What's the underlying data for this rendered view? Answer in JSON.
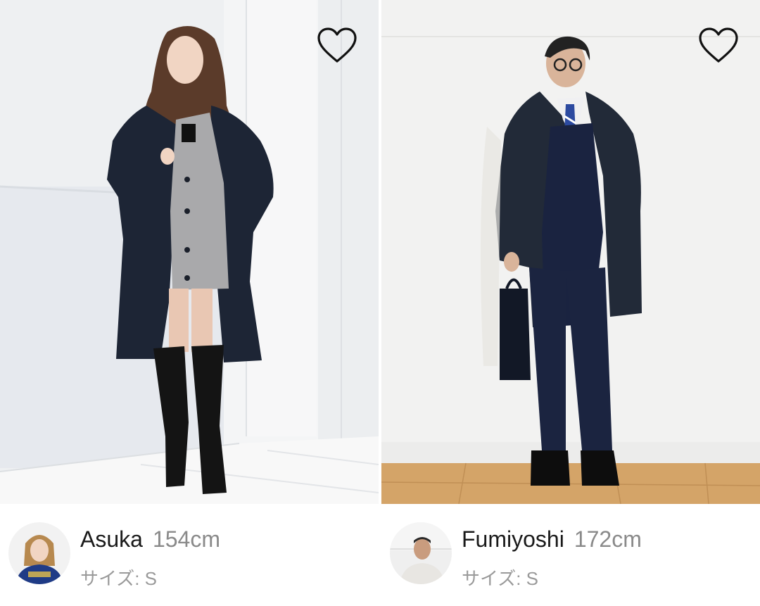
{
  "cards": [
    {
      "name": "Asuka",
      "height": "154cm",
      "size_label": "サイズ: S",
      "favorite_icon": "heart-outline-icon"
    },
    {
      "name": "Fumiyoshi",
      "height": "172cm",
      "size_label": "サイズ: S",
      "favorite_icon": "heart-outline-icon"
    }
  ],
  "colors": {
    "wall": "#f1f2f3",
    "navy_coat": "#1e2736",
    "gray_cardigan": "#a9a9ab",
    "floor_wood": "#d6a86a",
    "text_primary": "#1a1a1a",
    "text_secondary": "#8a8a8a"
  }
}
